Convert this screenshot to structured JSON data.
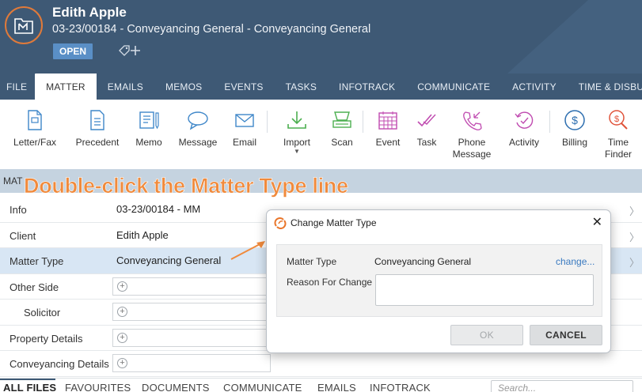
{
  "header": {
    "client_name": "Edith Apple",
    "matter_description": "03-23/00184 - Conveyancing General - Conveyancing General",
    "status": "OPEN"
  },
  "tabs": [
    "FILE",
    "MATTER",
    "EMAILS",
    "MEMOS",
    "EVENTS",
    "TASKS",
    "INFOTRACK",
    "COMMUNICATE",
    "ACTIVITY",
    "TIME & DISBURSEMENTS"
  ],
  "active_tab": "MATTER",
  "ribbon": {
    "letter_fax": "Letter/Fax",
    "precedent": "Precedent",
    "memo": "Memo",
    "message": "Message",
    "email": "Email",
    "import": "Import",
    "scan": "Scan",
    "event": "Event",
    "task": "Task",
    "phone_message_line1": "Phone",
    "phone_message_line2": "Message",
    "activity": "Activity",
    "billing": "Billing",
    "time_finder_line1": "Time",
    "time_finder_line2": "Finder"
  },
  "section": {
    "title": "MAT",
    "instruction": "Double-click the Matter Type line"
  },
  "rows": [
    {
      "label": "Info",
      "value": "03-23/00184 - MM"
    },
    {
      "label": "Client",
      "value": "Edith Apple"
    },
    {
      "label": "Matter Type",
      "value": "Conveyancing General"
    },
    {
      "label": "Other Side",
      "value": ""
    },
    {
      "label": "Solicitor",
      "value": ""
    },
    {
      "label": "Property Details",
      "value": ""
    },
    {
      "label": "Conveyancing Details",
      "value": ""
    }
  ],
  "bottom_tabs": [
    "ALL FILES",
    "FAVOURITES",
    "DOCUMENTS",
    "COMMUNICATE",
    "EMAILS",
    "INFOTRACK"
  ],
  "search": {
    "placeholder": "Search..."
  },
  "dialog": {
    "title": "Change Matter Type",
    "matter_type_label": "Matter Type",
    "matter_type_value": "Conveyancing General",
    "change_link": "change...",
    "reason_label": "Reason For Change",
    "ok_label": "OK",
    "cancel_label": "CANCEL"
  },
  "colors": {
    "header_bg": "#3e5975",
    "accent_orange": "#f08a3c",
    "status_badge": "#5a8fc6",
    "selected_row": "#d8e6f4",
    "link": "#3a7ac0"
  }
}
